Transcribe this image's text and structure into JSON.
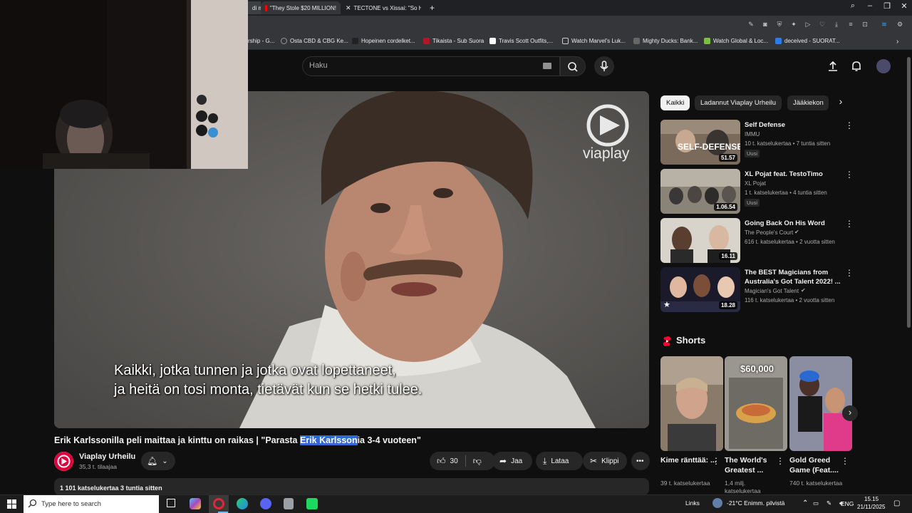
{
  "browser": {
    "tabs": [
      {
        "label": "di m"
      },
      {
        "label": "\"They Stole $20 MILLION!"
      },
      {
        "label": "TECTONE vs Xissai: \"So Ha"
      }
    ],
    "bookmarks": [
      {
        "label": "rship - G..."
      },
      {
        "label": "Osta CBD & CBG Ke..."
      },
      {
        "label": "Hopeinen cordelket..."
      },
      {
        "label": "Tikaista - Sub Suora"
      },
      {
        "label": "Travis Scott Outfits,..."
      },
      {
        "label": "Watch Marvel's Luk..."
      },
      {
        "label": "Mighty Ducks: Bank..."
      },
      {
        "label": "Watch Global & Loc..."
      },
      {
        "label": "deceived - SUORAT..."
      }
    ]
  },
  "header": {
    "search_placeholder": "Haku"
  },
  "player": {
    "watermark": "viaplay",
    "subtitle_line1": "Kaikki, jotka tunnen ja jotka ovat lopettaneet,",
    "subtitle_line2": "ja heitä on tosi monta, tietävät kun se hetki tulee."
  },
  "video": {
    "title_before": "Erik Karlssonilla peli maittaa ja kinttu on raikas | \"Parasta ",
    "title_highlight": "Erik Karlsson",
    "title_after": "ia 3-4 vuoteen\"",
    "channel_name": "Viaplay Urheilu",
    "subscribers": "35,3 t. tilaajaa",
    "likes": "30",
    "share_label": "Jaa",
    "download_label": "Lataa",
    "clip_label": "Klippi",
    "views_time": "1 101 katselukertaa  3 tuntia sitten"
  },
  "sidebar": {
    "chips": [
      {
        "label": "Kaikki",
        "active": true
      },
      {
        "label": "Ladannut Viaplay Urheilu",
        "active": false
      },
      {
        "label": "Jääkiekon",
        "active": false
      }
    ],
    "recommendations": [
      {
        "title": "Self Defense",
        "channel": "IMMU",
        "meta": "10 t. katselukertaa • 7 tuntia sitten",
        "badge": "Uusi",
        "duration": "51.57"
      },
      {
        "title": "XL Pojat feat. TestoTimo",
        "channel": "XL Pojat",
        "meta": "1 t. katselukertaa • 4 tuntia sitten",
        "badge": "Uusi",
        "duration": "1.06.54"
      },
      {
        "title": "Going Back On His Word",
        "channel": "The People's Court",
        "meta": "616 t. katselukertaa • 2 vuotta sitten",
        "badge": "",
        "duration": "16.11"
      },
      {
        "title": "The BEST Magicians from Australia's Got Talent 2022! ...",
        "channel": "Magician's Got Talent",
        "meta": "116 t. katselukertaa • 2 vuotta sitten",
        "badge": "",
        "duration": "18.28"
      }
    ],
    "shorts_heading": "Shorts",
    "shorts": [
      {
        "title": "Kime ränttää: ...",
        "views": "39 t. katselukertaa",
        "overlay": ""
      },
      {
        "title": "The World's Greatest ...",
        "views": "1,4 milj. katselukertaa",
        "overlay": "$60,000"
      },
      {
        "title": "Gold Greed Game (Feat....",
        "views": "740 t. katselukertaa",
        "overlay": ""
      }
    ]
  },
  "taskbar": {
    "search_placeholder": "Type here to search",
    "links_label": "Links",
    "weather": "-21°C  Enimm. pilvistä",
    "language": "ENG",
    "time": "15.15",
    "date": "21/11/2025"
  },
  "colors": {
    "background": "#0f0f0f",
    "accent_red": "#ff0000",
    "highlight": "#3367d6"
  }
}
